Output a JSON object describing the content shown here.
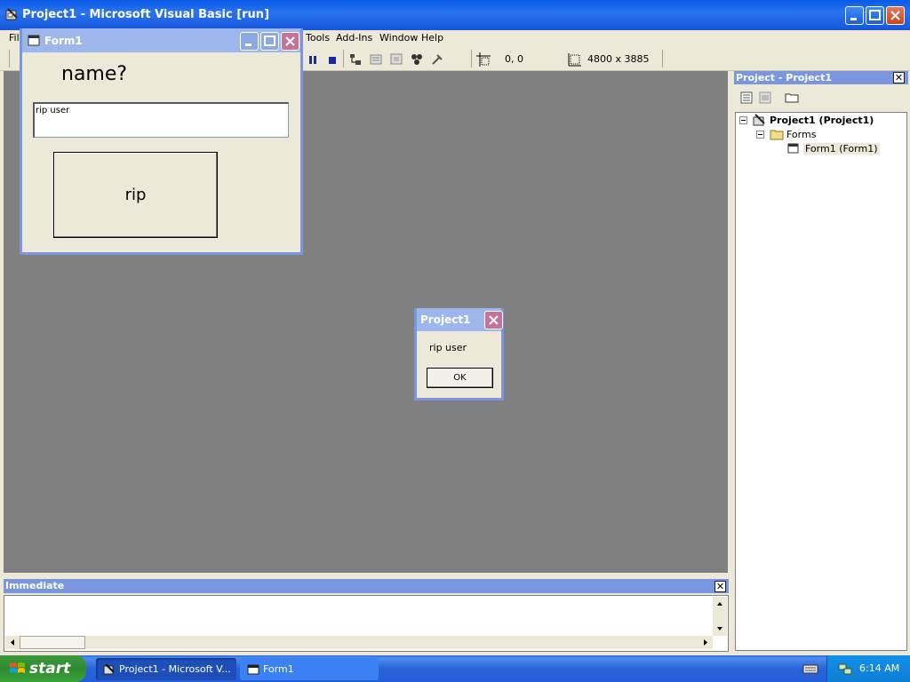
{
  "main_window": {
    "title": "Project1 - Microsoft Visual Basic [run]"
  },
  "menu": {
    "items": [
      {
        "label": "File",
        "visible": "Fil"
      },
      {
        "label": "Tools"
      },
      {
        "label": "Add-Ins"
      },
      {
        "label": "Window"
      },
      {
        "label": "Help"
      }
    ]
  },
  "toolbar": {
    "position_readout": "0, 0",
    "size_readout": "4800 x 3885"
  },
  "project_explorer": {
    "title": "Project - Project1",
    "close_glyph": "✕",
    "tree": {
      "project": "Project1 (Project1)",
      "folder": "Forms",
      "form": "Form1 (Form1)"
    }
  },
  "immediate": {
    "title": "Immediate",
    "close_glyph": "✕"
  },
  "form1": {
    "title": "Form1",
    "label": "name?",
    "textbox_value": "rip user",
    "button_label": "rip"
  },
  "msgbox": {
    "title": "Project1",
    "message": "rip user",
    "ok_label": "OK"
  },
  "taskbar": {
    "start_label": "start",
    "buttons": [
      {
        "label": "Project1 - Microsoft V..."
      },
      {
        "label": "Form1"
      }
    ],
    "clock": "6:14 AM"
  },
  "colors": {
    "titlebar_active": "#0a5ae8",
    "titlebar_inactive": "#9db7ec",
    "mdi_background": "#808080",
    "panel_title": "#7a96df",
    "taskbar": "#245edb",
    "start_green": "#3aa43a"
  }
}
